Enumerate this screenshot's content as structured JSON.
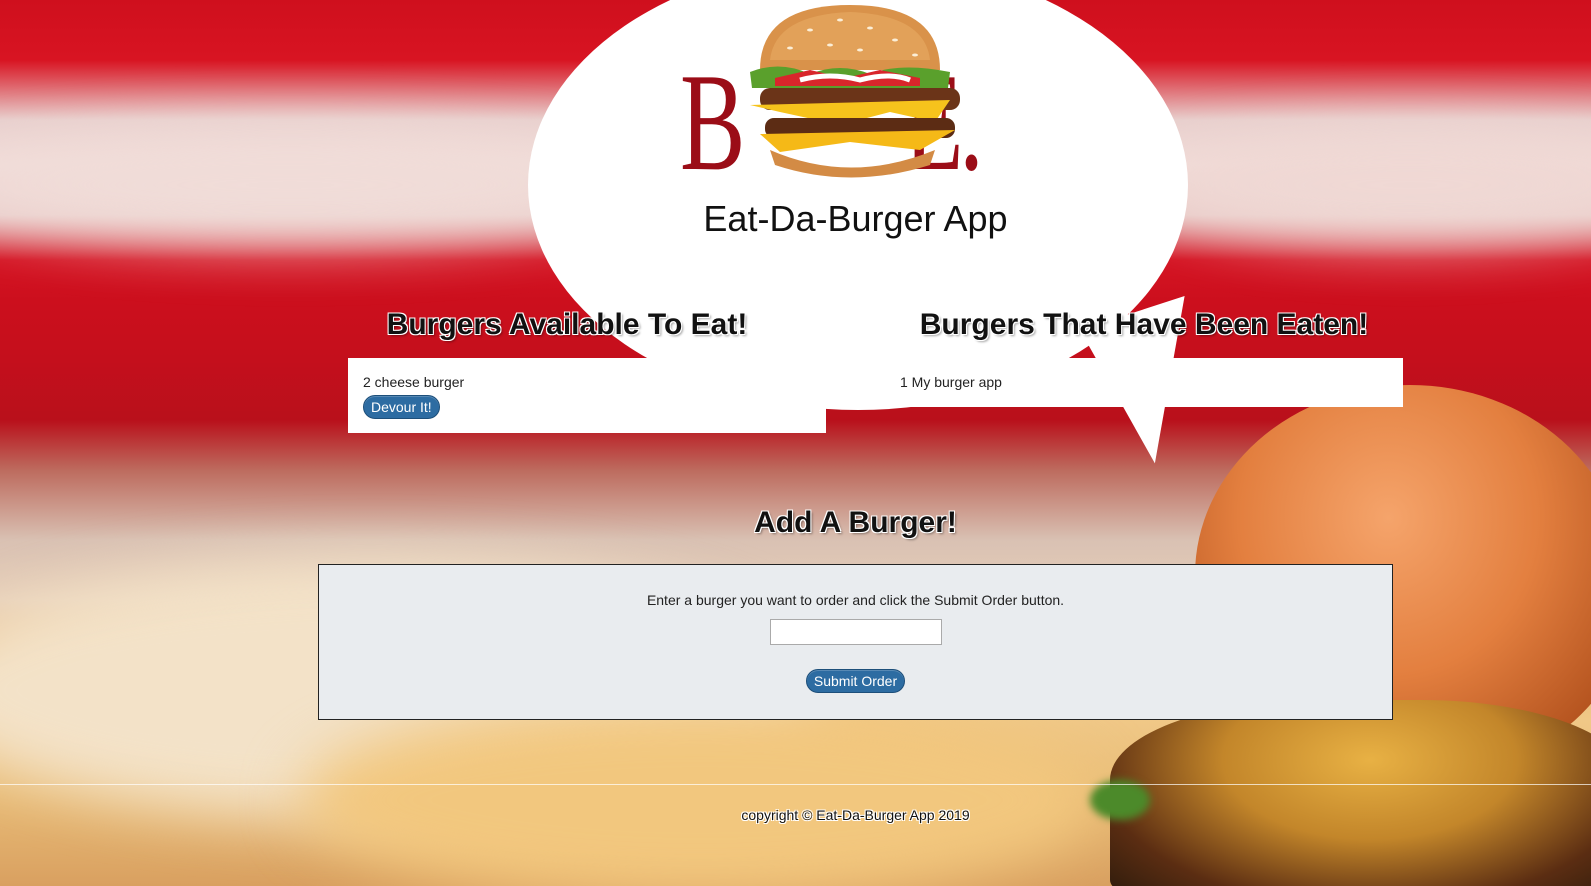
{
  "header": {
    "logo_text": "BITE ME.",
    "app_title": "Eat-Da-Burger App"
  },
  "available": {
    "heading": "Burgers Available To Eat!",
    "items": [
      {
        "label": "2 cheese burger",
        "button_label": "Devour It!"
      }
    ]
  },
  "eaten": {
    "heading": "Burgers That Have Been Eaten!",
    "items": [
      {
        "label": "1 My burger app"
      }
    ]
  },
  "add_burger": {
    "heading": "Add A Burger!",
    "instructions": "Enter a burger you want to order and click the Submit Order button.",
    "input_value": "",
    "input_placeholder": "",
    "submit_label": "Submit Order"
  },
  "footer": {
    "copyright": "copyright © Eat-Da-Burger App 2019"
  },
  "colors": {
    "button": "#2d6ca2",
    "form_background": "#e9ecef",
    "background_red": "#d01422"
  }
}
